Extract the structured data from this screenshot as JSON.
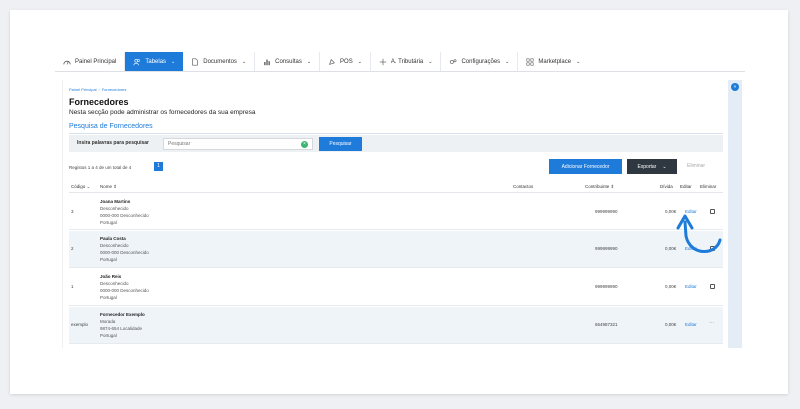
{
  "nav": {
    "items": [
      {
        "label": "Painel Principal",
        "icon": "dashboard-icon",
        "chevron": false
      },
      {
        "label": "Tabelas",
        "icon": "users-icon",
        "chevron": true,
        "active": true
      },
      {
        "label": "Documentos",
        "icon": "document-icon",
        "chevron": true
      },
      {
        "label": "Consultas",
        "icon": "chart-icon",
        "chevron": true
      },
      {
        "label": "POS",
        "icon": "pos-icon",
        "chevron": true
      },
      {
        "label": "A. Tributária",
        "icon": "tax-icon",
        "chevron": true
      },
      {
        "label": "Configurações",
        "icon": "gears-icon",
        "chevron": true
      },
      {
        "label": "Marketplace",
        "icon": "marketplace-icon",
        "chevron": true
      }
    ]
  },
  "breadcrumb": {
    "home": "Painel Principal",
    "current": "Fornecedores"
  },
  "page": {
    "title": "Fornecedores",
    "subtitle": "Nesta secção pode administrar os fornecedores da sua empresa"
  },
  "search": {
    "section_title": "Pesquisa de Fornecedores",
    "label": "Insira palavras para pesquisar",
    "placeholder": "Pesquisar",
    "clear": "×",
    "button": "Pesquisar"
  },
  "toolbar": {
    "records": "Registos 1 a 4 de um total de 4",
    "page": "1",
    "add": "Adicionar Fornecedor",
    "export": "Exportar",
    "export_chevron": "⌄",
    "delete": "Eliminar"
  },
  "table": {
    "headers": {
      "code": "Código ⌄",
      "name": "Nome ⇕",
      "contacts": "Contactos",
      "taxpayer": "Contribuinte ⇕",
      "debt": "Dívida",
      "edit": "Editar",
      "delete": "Eliminar"
    },
    "rows": [
      {
        "code": "3",
        "name": "Joana Martins",
        "address": [
          "Desconhecido",
          "0000-000 Desconhecido",
          "Portugal"
        ],
        "taxpayer": "999999990",
        "debt": "0,00€",
        "edit": "Editar",
        "action": "checkbox"
      },
      {
        "code": "2",
        "name": "Paula Costa",
        "address": [
          "Desconhecido",
          "0000-000 Desconhecido",
          "Portugal"
        ],
        "taxpayer": "999999990",
        "debt": "0,00€",
        "edit": "Editar",
        "action": "checkbox"
      },
      {
        "code": "1",
        "name": "João Reis",
        "address": [
          "Desconhecido",
          "0000-000 Desconhecido",
          "Portugal"
        ],
        "taxpayer": "999999990",
        "debt": "0,00€",
        "edit": "Editar",
        "action": "checkbox"
      },
      {
        "code": "exemplo",
        "name": "Fornecedor Exemplo",
        "address": [
          "Morada",
          "9874-654 Localidade",
          "Portugal"
        ],
        "taxpayer": "654987321",
        "debt": "0,00€",
        "edit": "Editar",
        "action": "dots",
        "dots": "···"
      }
    ]
  },
  "rightbar": {
    "badge": "«"
  },
  "colors": {
    "accent": "#1e7bd9",
    "dark": "#2f3740",
    "arrow": "#1e7bd9"
  }
}
